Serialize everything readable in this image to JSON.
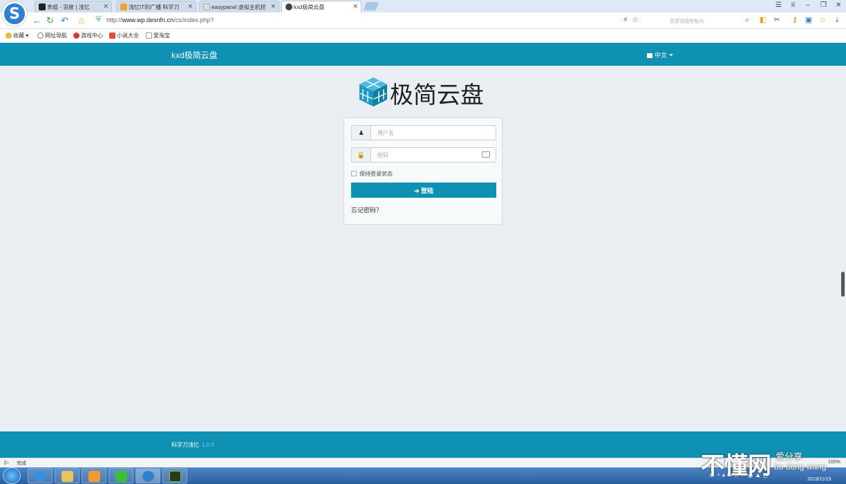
{
  "browser": {
    "tabs": [
      {
        "label": "表姐 - 羽泉 | 浅忆",
        "fav_color": "#222222"
      },
      {
        "label": "浅忆IT的广播 科学刀",
        "fav_color": "#f2a23b"
      },
      {
        "label": "easypanel 虚拟主机控",
        "fav_color": "#dddddd"
      },
      {
        "label": "kxd极简云盘",
        "fav_color": "#444444"
      }
    ],
    "url_prefix": "http://",
    "url_host": "www.wp.desnfn.cn",
    "url_path": "/cs/index.php?",
    "search_placeholder": "共享浏览所有内",
    "bookmarks": [
      "收藏",
      "网址导航",
      "游戏中心",
      "小说大全",
      "爱淘宝"
    ],
    "status": "完成",
    "zoom": "100%"
  },
  "site": {
    "brand": "kxd极简云盘",
    "language": "中文",
    "logo_text": "极简云盘",
    "username_placeholder": "用户名",
    "password_placeholder": "密码",
    "remember_label": "保持登录状态",
    "login_label": "登陆",
    "forgot_label": "忘记密码？",
    "footer_author": "科学刀浅忆",
    "footer_version": "1.0.0",
    "colors": {
      "primary": "#0f91b4",
      "background": "#eaeef3"
    }
  },
  "taskbar": {
    "date": "2019/11/19"
  },
  "watermark": {
    "main": "不懂网",
    "sub": "爱分享",
    "pinyin": "bu dong wang"
  }
}
